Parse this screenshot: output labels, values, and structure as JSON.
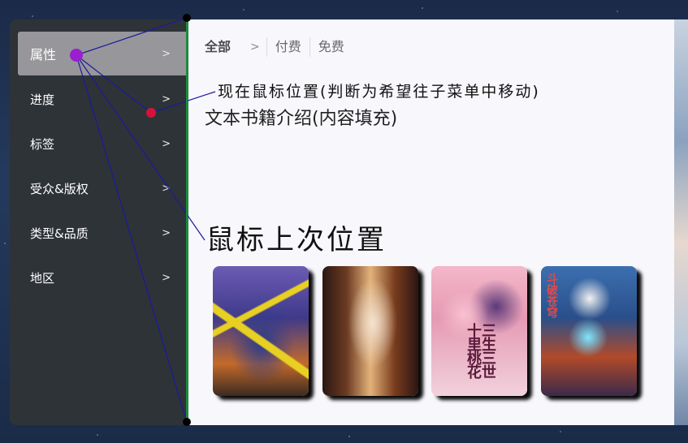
{
  "sidebar": {
    "items": [
      {
        "label": "属性",
        "arrow": ">"
      },
      {
        "label": "进度",
        "arrow": ">"
      },
      {
        "label": "标签",
        "arrow": ">"
      },
      {
        "label": "受众&版权",
        "arrow": ">"
      },
      {
        "label": "类型&品质",
        "arrow": ">"
      },
      {
        "label": "地区",
        "arrow": ">"
      }
    ]
  },
  "filter_tabs": {
    "all": "全部",
    "chevron": ">",
    "paid": "付费",
    "free": "免费"
  },
  "content": {
    "hint_current": "现在鼠标位置(判断为希望往子菜单中移动)",
    "intro": "文本书籍介绍(内容填充)",
    "hint_last": "鼠标上次位置"
  },
  "books": [
    {
      "cover": "detective-anime-cover",
      "title_text": ""
    },
    {
      "cover": "swordsman-anime-cover",
      "title_text": ""
    },
    {
      "cover": "romance-anime-cover",
      "title_text": "三生三世十里桃花"
    },
    {
      "cover": "magic-anime-cover",
      "title_text": "斗破苍穹"
    }
  ],
  "colors": {
    "sidebar_bg": "#2e3338",
    "sidebar_active": "#97969a",
    "content_bg": "#f8f7fc",
    "divider_green": "#1e8a3c",
    "mouse_current_dot": "#9a1fd0",
    "mouse_last_dot": "#d8123c",
    "guide_line": "#1a1aa0"
  }
}
